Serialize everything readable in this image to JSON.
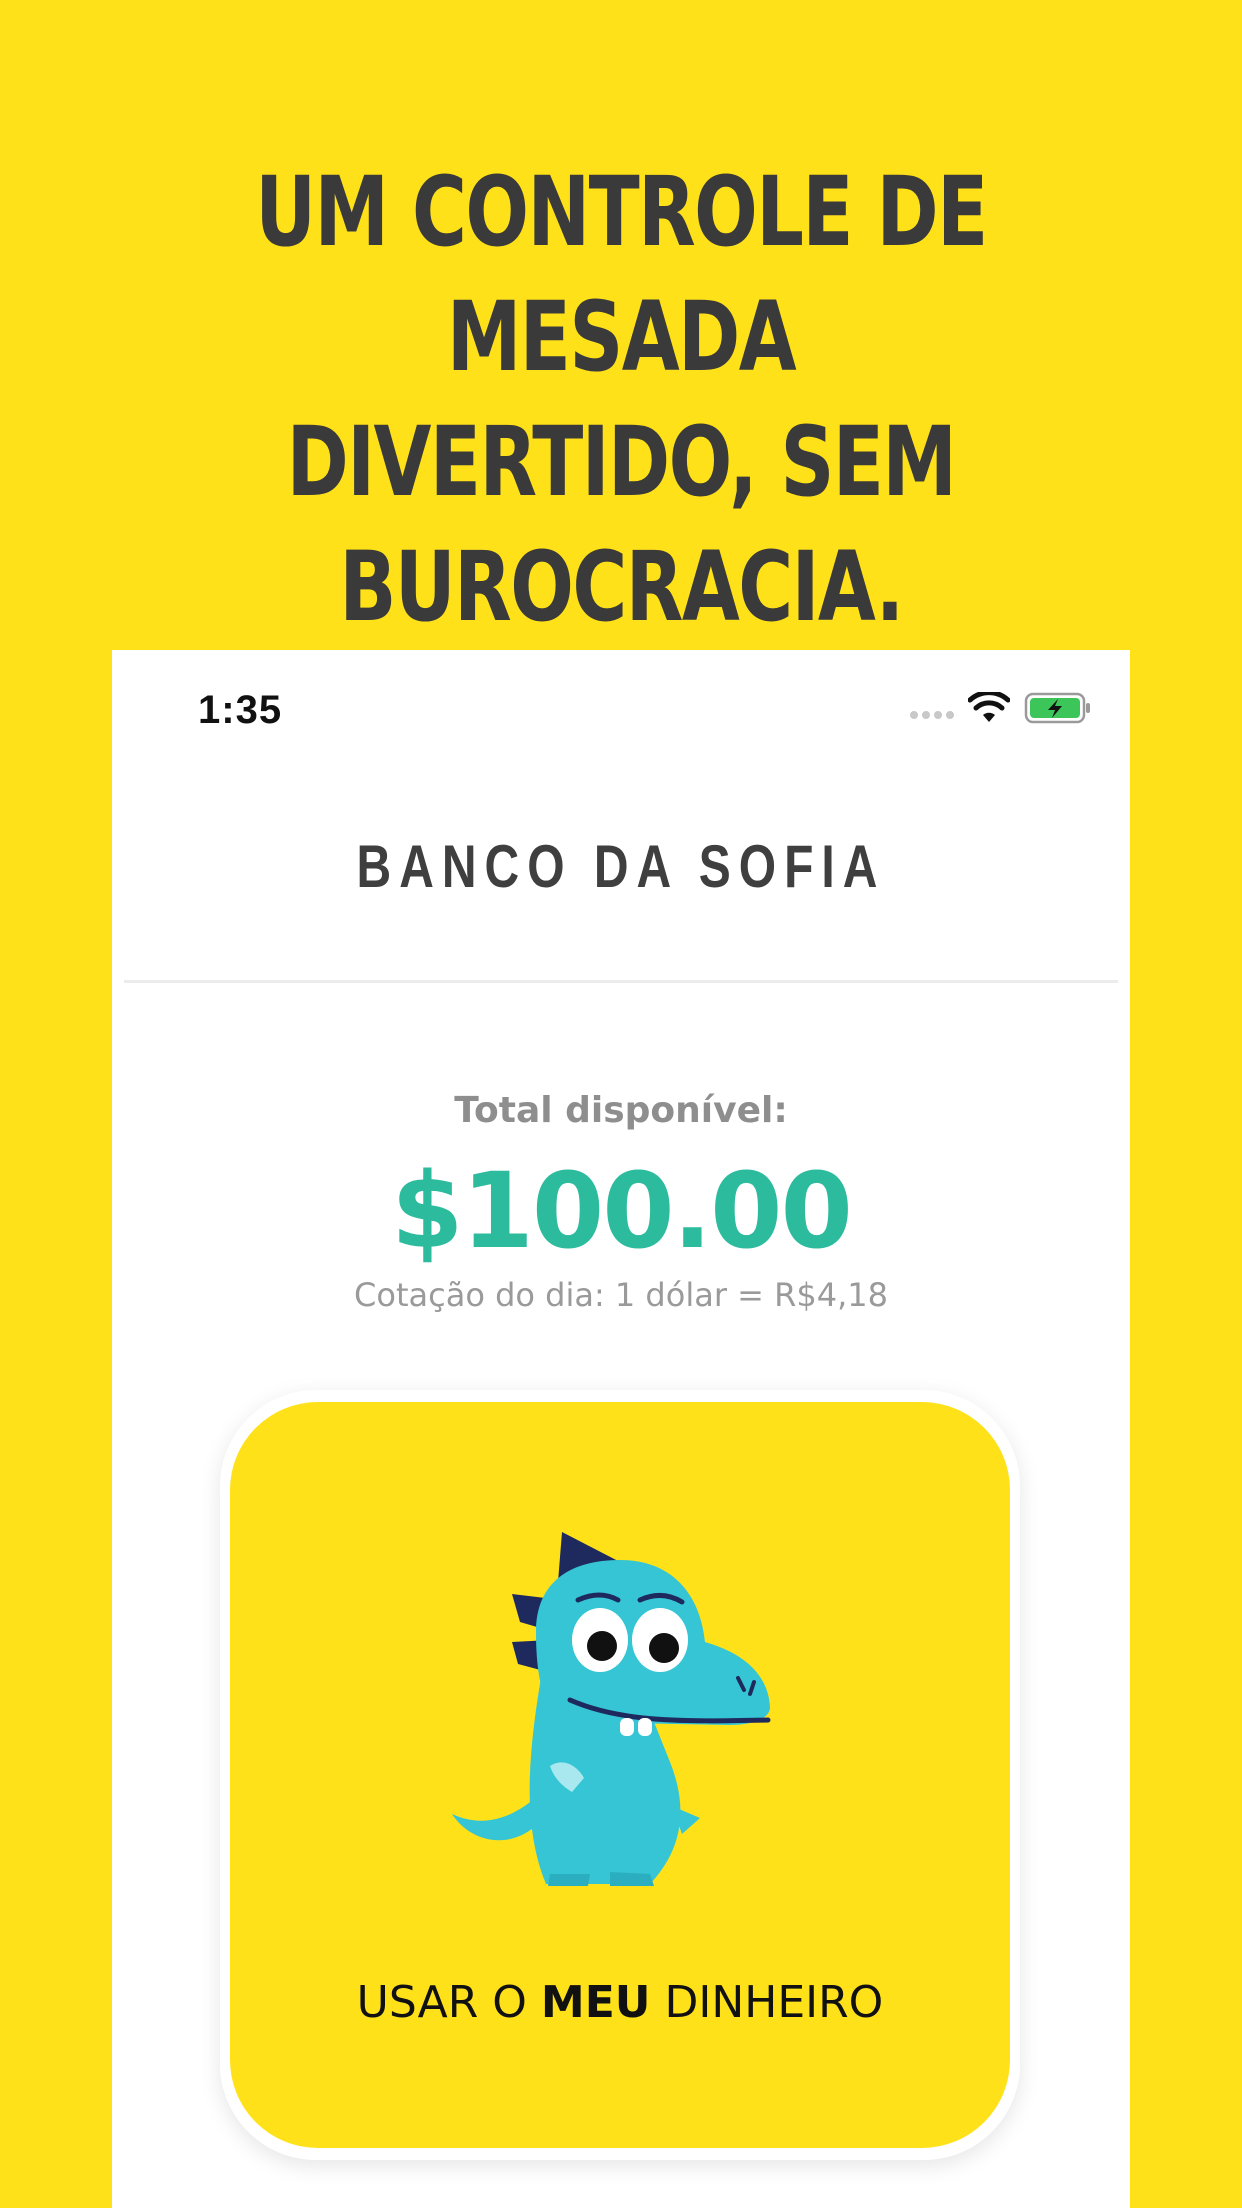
{
  "headline": {
    "line1": "UM CONTROLE DE MESADA",
    "line2": "DIVERTIDO, SEM",
    "line3": "BUROCRACIA."
  },
  "status_bar": {
    "time": "1:35",
    "icons": [
      "signal-dots-icon",
      "wifi-icon",
      "battery-charging-icon"
    ]
  },
  "header": {
    "title": "BANCO DA SOFIA"
  },
  "balance": {
    "label": "Total disponível:",
    "amount": "$100.00",
    "exchange_rate": "Cotação do dia: 1 dólar = R$4,18"
  },
  "action_card": {
    "label_pre": "USAR O ",
    "label_bold": "MEU",
    "label_post": " DINHEIRO",
    "mascot": "dinosaur-mascot"
  },
  "colors": {
    "background": "#FFE11A",
    "accent_green": "#2DBB9E",
    "headline_text": "#3A3A3A",
    "dino_body": "#35C5D4",
    "dino_spikes": "#1E2A5E"
  }
}
